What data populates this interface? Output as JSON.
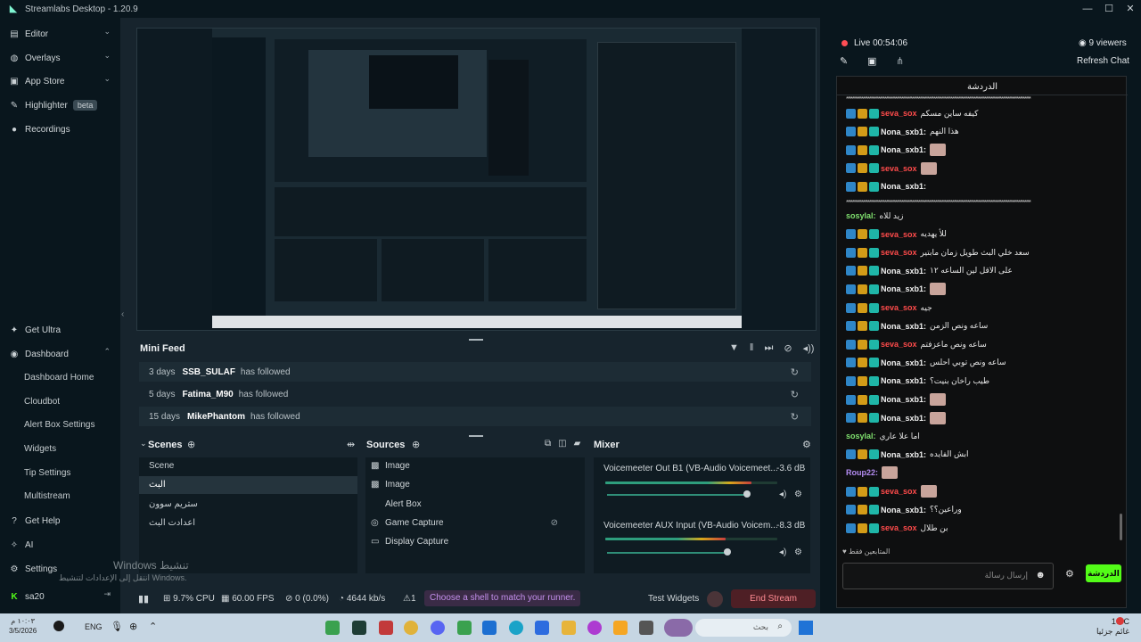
{
  "app": {
    "title": "Streamlabs Desktop - 1.20.9"
  },
  "sidebar": {
    "top_items": [
      {
        "label": "Editor"
      },
      {
        "label": "Overlays"
      },
      {
        "label": "App Store"
      },
      {
        "label": "Highlighter",
        "badge": "beta"
      },
      {
        "label": "Recordings"
      }
    ],
    "get_ultra": "Get Ultra",
    "dashboard": "Dashboard",
    "dashboard_items": [
      "Dashboard Home",
      "Cloudbot",
      "Alert Box Settings",
      "Widgets",
      "Tip Settings",
      "Multistream"
    ],
    "get_help": "Get Help",
    "ai": "AI",
    "settings": "Settings",
    "user": "sa20"
  },
  "minifeed": {
    "title": "Mini Feed",
    "rows": [
      {
        "days": "3 days",
        "name": "SSB_SULAF",
        "action": "has followed"
      },
      {
        "days": "5 days",
        "name": "Fatima_M90",
        "action": "has followed"
      },
      {
        "days": "15 days",
        "name": "MikePhantom",
        "action": "has followed"
      }
    ]
  },
  "scenes": {
    "title": "Scenes",
    "items": [
      "Scene",
      "البث",
      "ستريم سوون",
      "اعدادت البث"
    ]
  },
  "sources": {
    "title": "Sources",
    "items": [
      {
        "label": "Image",
        "icon": "image-icon"
      },
      {
        "label": "Image",
        "icon": "image-icon"
      },
      {
        "label": "Alert Box",
        "icon": "alert-icon"
      },
      {
        "label": "Game Capture",
        "icon": "gamepad-icon"
      },
      {
        "label": "Display Capture",
        "icon": "monitor-icon"
      }
    ]
  },
  "mixer": {
    "title": "Mixer",
    "channels": [
      {
        "name": "Voicemeeter Out B1 (VB-Audio Voicemeet...",
        "db": "-3.6 dB",
        "level": 0.85
      },
      {
        "name": "Voicemeeter AUX Input (VB-Audio Voicem...",
        "db": "-8.3 dB",
        "level": 0.7
      }
    ]
  },
  "status": {
    "cpu": "9.7% CPU",
    "fps": "60.00 FPS",
    "dropped": "0 (0.0%)",
    "bitrate": "4644 kb/s",
    "alerts": "1",
    "tip": "Choose a shell to match your runner.",
    "test_widgets": "Test Widgets",
    "end_stream": "End Stream"
  },
  "watermark": {
    "line1": "Windows تنشيط",
    "line2": "انتقل إلى الإعدادات لتنشيط Windows."
  },
  "chat": {
    "live": "Live 00:54:06",
    "viewers": "9 viewers",
    "refresh": "Refresh Chat",
    "tab_title": "الدردشة",
    "send_label": "الدردشة",
    "input_placeholder": "إرسال رسالة",
    "messages": [
      {
        "user": "seva_sox",
        "color": "red",
        "text": "كيفه ساين مسكم"
      },
      {
        "user": "Nona_sxb1:",
        "color": "white",
        "text": "هذا النهم"
      },
      {
        "user": "Nona_sxb1:",
        "color": "white",
        "text": "",
        "emote": true
      },
      {
        "user": "seva_sox",
        "color": "red",
        "text": "",
        "emote": true
      },
      {
        "user": "Nona_sxb1:",
        "color": "white",
        "text": ""
      },
      {
        "user": "sosylal:",
        "color": "green",
        "text": "زيد للاه"
      },
      {
        "user": "seva_sox",
        "color": "red",
        "text": "للأ يهديه"
      },
      {
        "user": "seva_sox",
        "color": "red",
        "text": "سعد خلي البث طويل زمان مابتير"
      },
      {
        "user": "Nona_sxb1:",
        "color": "white",
        "text": "على الاقل لين الساعه ١٢"
      },
      {
        "user": "Nona_sxb1:",
        "color": "white",
        "text": "",
        "emote": true
      },
      {
        "user": "seva_sox",
        "color": "red",
        "text": "جيه"
      },
      {
        "user": "Nona_sxb1:",
        "color": "white",
        "text": "ساعه ونص الزمن"
      },
      {
        "user": "seva_sox",
        "color": "red",
        "text": "ساعه ونص ماعزفتم"
      },
      {
        "user": "Nona_sxb1:",
        "color": "white",
        "text": "ساعه ونص توبي احلس"
      },
      {
        "user": "Nona_sxb1:",
        "color": "white",
        "text": "طيب راخان بنيت؟"
      },
      {
        "user": "Nona_sxb1:",
        "color": "white",
        "text": "",
        "emote": true
      },
      {
        "user": "Nona_sxb1:",
        "color": "white",
        "text": "",
        "emote": true
      },
      {
        "user": "sosylal:",
        "color": "green",
        "text": "اما علا عاري"
      },
      {
        "user": "Nona_sxb1:",
        "color": "white",
        "text": "ابش الفايده"
      },
      {
        "user": "Roup22:",
        "color": "purple",
        "text": "",
        "emote": true
      },
      {
        "user": "seva_sox",
        "color": "red",
        "text": "",
        "emote": true
      },
      {
        "user": "Nona_sxb1:",
        "color": "white",
        "text": "وراعين؟؟"
      },
      {
        "user": "seva_sox",
        "color": "red",
        "text": "بن طلال"
      }
    ],
    "footer_note": "المتابعين فقط"
  },
  "taskbar": {
    "time": "١٠:٠٣ م",
    "date": "3/5/2026",
    "lang": "ENG",
    "weather_temp": "16°C",
    "weather_desc": "غائم جزئيا",
    "search": "بحث"
  }
}
